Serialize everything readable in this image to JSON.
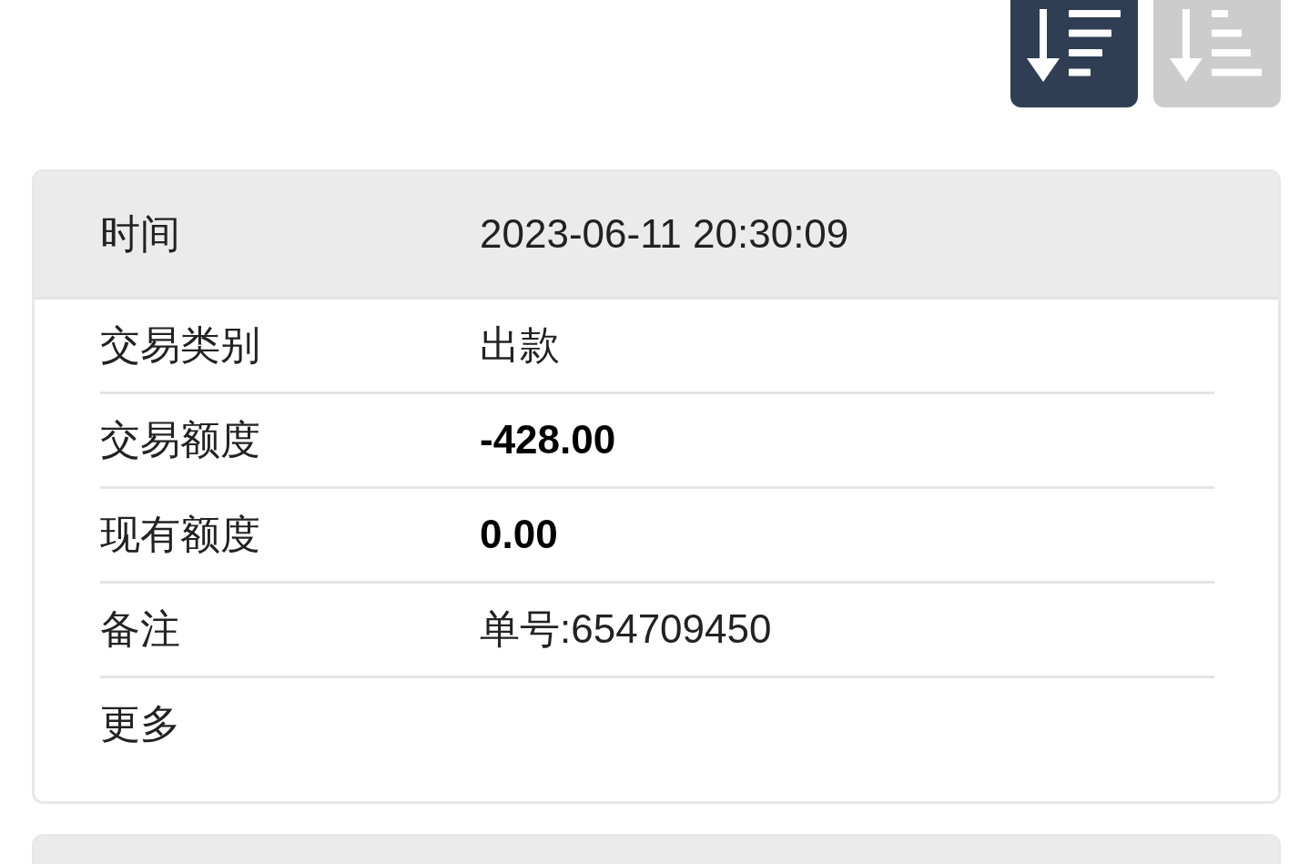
{
  "sort_buttons": [
    {
      "kind": "descending",
      "selected": true
    },
    {
      "kind": "ascending",
      "selected": false
    }
  ],
  "record": {
    "header": {
      "label": "时间",
      "value": "2023-06-11 20:30:09"
    },
    "fields": [
      {
        "label": "交易类别",
        "value": "出款",
        "bold": false
      },
      {
        "label": "交易额度",
        "value": "-428.00",
        "bold": true
      },
      {
        "label": "现有额度",
        "value": "0.00",
        "bold": true
      },
      {
        "label": "备注",
        "value": "单号:654709450",
        "bold": false
      },
      {
        "label": "更多"
      }
    ]
  }
}
